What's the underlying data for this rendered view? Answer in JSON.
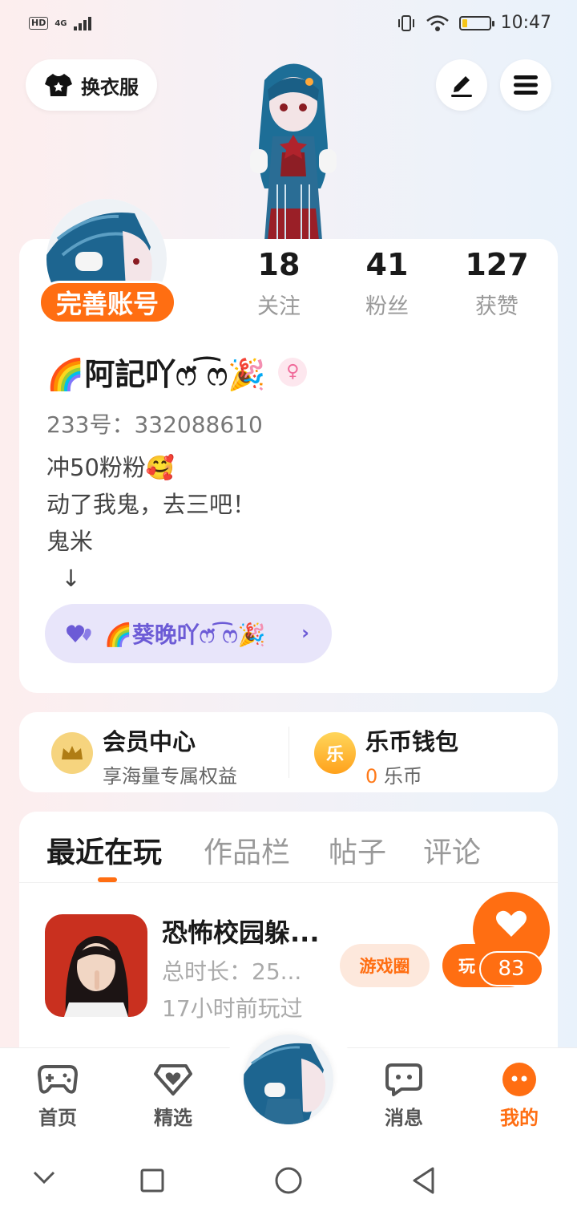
{
  "status_bar": {
    "hd": "HD",
    "network": "4G",
    "time": "10:47",
    "battery_level": 0.2
  },
  "top_actions": {
    "dress_up_label": "换衣服"
  },
  "profile": {
    "complete_account_label": "完善账号",
    "stats": [
      {
        "value": "18",
        "label": "关注"
      },
      {
        "value": "41",
        "label": "粉丝"
      },
      {
        "value": "127",
        "label": "获赞"
      }
    ],
    "nickname": "🌈阿記吖ෆ̈ ͡ෆ🎉",
    "gender_symbol": "♀",
    "account_id": "233号：332088610",
    "bio": "冲50粉粉🥰\n动了我鬼，去三吧！\n鬼米\n  ↓",
    "linked_user": "🌈葵晚吖ෆ̈ ͡ෆ🎉"
  },
  "wallet": {
    "vip_title": "会员中心",
    "vip_sub": "享海量专属权益",
    "coin_icon_text": "乐",
    "coin_title": "乐币钱包",
    "coin_amount": "0",
    "coin_unit": "乐币"
  },
  "tabs": [
    "最近在玩",
    "作品栏",
    "帖子",
    "评论"
  ],
  "recent_game": {
    "title": "恐怖校园躲...",
    "duration": "总时长：25...",
    "last_played": "17小时前玩过",
    "circle_label": "游戏圈",
    "play_label": "玩"
  },
  "like_float": {
    "count": "83"
  },
  "bottom_nav": {
    "home": "首页",
    "featured": "精选",
    "messages": "消息",
    "mine": "我的"
  },
  "colors": {
    "accent": "#ff6e12",
    "chip_purple": "#6c5bd6",
    "chip_bg": "#e8e5fa"
  },
  "icons": [
    "tshirt-icon",
    "edit-icon",
    "menu-icon",
    "crown-icon",
    "coin-icon",
    "heart-icon",
    "gamepad-icon",
    "heart-diamond-icon",
    "chat-icon",
    "mine-icon"
  ]
}
